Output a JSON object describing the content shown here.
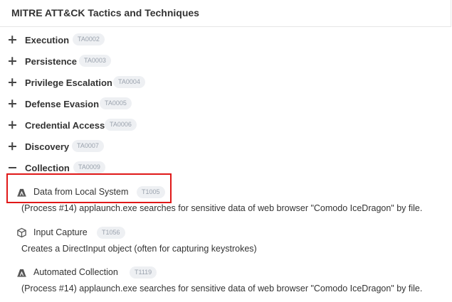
{
  "panel": {
    "title": "MITRE ATT&CK Tactics and Techniques"
  },
  "tactics": [
    {
      "name": "Execution",
      "id": "TA0002",
      "expanded": false
    },
    {
      "name": "Persistence",
      "id": "TA0003",
      "expanded": false
    },
    {
      "name": "Privilege Escalation",
      "id": "TA0004",
      "expanded": false
    },
    {
      "name": "Defense Evasion",
      "id": "TA0005",
      "expanded": false
    },
    {
      "name": "Credential Access",
      "id": "TA0006",
      "expanded": false
    },
    {
      "name": "Discovery",
      "id": "TA0007",
      "expanded": false
    },
    {
      "name": "Collection",
      "id": "TA0009",
      "expanded": true
    }
  ],
  "techniques": [
    {
      "name": "Data from Local System",
      "id": "T1005",
      "icon": "database-icon",
      "description": "(Process #14) applaunch.exe searches for sensitive data of web browser \"Comodo IceDragon\" by file."
    },
    {
      "name": "Input Capture",
      "id": "T1056",
      "icon": "cube-icon",
      "description": "Creates a DirectInput object (often for capturing keystrokes)"
    },
    {
      "name": "Automated Collection",
      "id": "T1119",
      "icon": "database-icon",
      "description": "(Process #14) applaunch.exe searches for sensitive data of web browser \"Comodo IceDragon\" by file."
    }
  ],
  "colors": {
    "highlight": "#e01818",
    "badge_bg": "#eef0f3",
    "badge_text": "#9aa2ad"
  }
}
